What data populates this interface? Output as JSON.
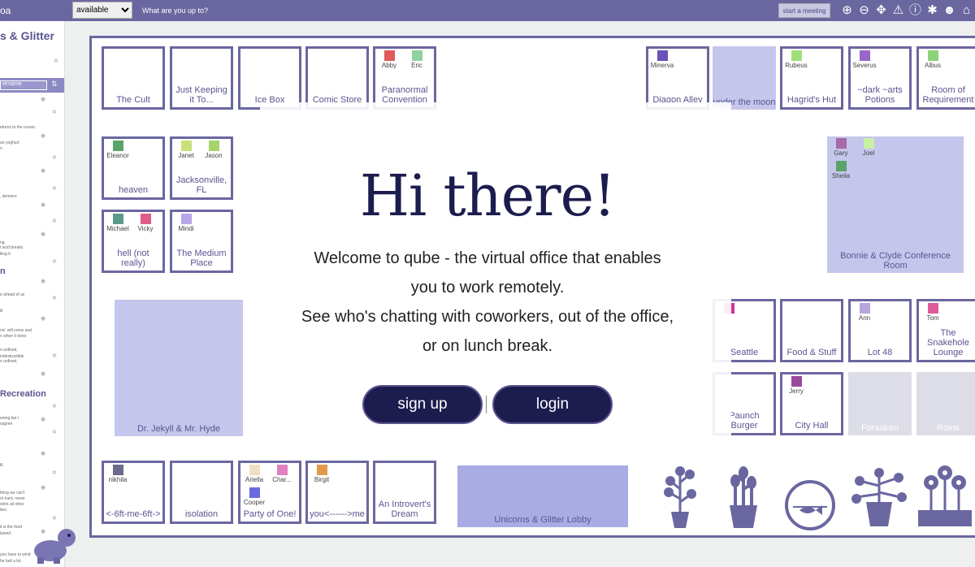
{
  "topbar": {
    "brand": "oa",
    "availability": "available",
    "status_placeholder": "What are you up to?",
    "meeting_button": "start a meeting",
    "icons": [
      "zoom-in-icon",
      "zoom-out-icon",
      "move-icon",
      "warning-icon",
      "info-icon",
      "bug-icon",
      "people-icon",
      "home-icon"
    ]
  },
  "sidebar": {
    "title": "s & Glitter",
    "search_placeholder": "ername",
    "section1": "n",
    "section2": "Recreation",
    "lines": [
      "eturns to the ocean.",
      "an yoghurt",
      "n",
      ", demons",
      "ng.",
      "t acid breaks",
      "lling it",
      "e ahead of us",
      "ill",
      "nic' will come and",
      "n when it does",
      "n unfixed,",
      "indestructible",
      "n unfixed,",
      "ening but i",
      "sagree",
      "ill.",
      "thing we can't",
      "rk hard, never",
      "shirk all other",
      "ties.",
      "it is the food",
      "lawed.",
      "you have to wind",
      "he ball a lot."
    ]
  },
  "rooms": [
    {
      "id": "the-cult",
      "name": "The Cult",
      "people": []
    },
    {
      "id": "just-keeping",
      "name": "Just Keeping it To...",
      "people": []
    },
    {
      "id": "ice-box",
      "name": "Ice Box",
      "people": []
    },
    {
      "id": "comic-store",
      "name": "Comic Store",
      "people": []
    },
    {
      "id": "paranormal",
      "name": "Paranormal Convention",
      "people": [
        {
          "name": "Abby",
          "color": "#e05a5a"
        },
        {
          "name": "Eric",
          "color": "#8fd19e"
        }
      ]
    },
    {
      "id": "diagon-alley",
      "name": "Diagon Alley",
      "people": [
        {
          "name": "Minerva",
          "color": "#6a52b8"
        }
      ]
    },
    {
      "id": "under-the-moon",
      "name": "under the moon",
      "people": []
    },
    {
      "id": "hagrids-hut",
      "name": "Hagrid's Hut",
      "people": [
        {
          "name": "Rubeus",
          "color": "#9fe07a"
        }
      ]
    },
    {
      "id": "dark-arts",
      "name": "~dark ~arts Potions",
      "people": [
        {
          "name": "Severus",
          "color": "#9a66cc"
        }
      ]
    },
    {
      "id": "room-of-req",
      "name": "Room of Requirement",
      "people": [
        {
          "name": "Albus",
          "color": "#8fd17a"
        }
      ]
    },
    {
      "id": "heaven",
      "name": "heaven",
      "people": [
        {
          "name": "Eleanor",
          "color": "#5aa46a"
        }
      ]
    },
    {
      "id": "jacksonville",
      "name": "Jacksonville, FL",
      "people": [
        {
          "name": "Janet",
          "color": "#c8e07a"
        },
        {
          "name": "Jason",
          "color": "#a6d46a"
        }
      ]
    },
    {
      "id": "hell",
      "name": "hell (not really)",
      "people": [
        {
          "name": "Michael",
          "color": "#5a9a8a"
        },
        {
          "name": "Vicky",
          "color": "#e05a8a"
        }
      ]
    },
    {
      "id": "medium-place",
      "name": "The Medium Place",
      "people": [
        {
          "name": "Mindi",
          "color": "#b8a6e8"
        }
      ]
    },
    {
      "id": "bonnie-clyde",
      "name": "Bonnie & Clyde Conference Room",
      "people": [
        {
          "name": "Gary",
          "color": "#a66aa6"
        },
        {
          "name": "Joel",
          "color": "#c8f0a6"
        },
        {
          "name": "Sheila",
          "color": "#5aa46a"
        }
      ]
    },
    {
      "id": "dr-jekyll",
      "name": "Dr. Jekyll & Mr. Hyde",
      "people": []
    },
    {
      "id": "seattle",
      "name": "Seattle",
      "people": [
        {
          "name": "",
          "color": "#cc3399"
        }
      ]
    },
    {
      "id": "food-stuff",
      "name": "Food & Stuff",
      "people": []
    },
    {
      "id": "lot-48",
      "name": "Lot 48",
      "people": [
        {
          "name": "Ann",
          "color": "#b8a6d8"
        }
      ]
    },
    {
      "id": "snakehole",
      "name": "The Snakehole Lounge",
      "people": [
        {
          "name": "Tom",
          "color": "#e05a9a"
        }
      ]
    },
    {
      "id": "paunch-burger",
      "name": "Paunch Burger",
      "people": []
    },
    {
      "id": "city-hall",
      "name": "City Hall",
      "people": [
        {
          "name": "Jerry",
          "color": "#9a4a9a"
        }
      ]
    },
    {
      "id": "forsaken",
      "name": "Forsaken",
      "people": []
    },
    {
      "id": "roins",
      "name": "Roins",
      "people": []
    },
    {
      "id": "6ft",
      "name": "<-6ft-me-6ft->",
      "people": [
        {
          "name": "nikhila",
          "color": "#6a6a8a"
        }
      ]
    },
    {
      "id": "isolation",
      "name": "isolation",
      "people": []
    },
    {
      "id": "party-of-one",
      "name": "Party of One!",
      "people": [
        {
          "name": "Ariella",
          "color": "#f0e0c0"
        },
        {
          "name": "Char...",
          "color": "#e080c0"
        },
        {
          "name": "Cooper",
          "color": "#6a6ae0"
        }
      ]
    },
    {
      "id": "you-me",
      "name": "you<------>me",
      "people": [
        {
          "name": "Birgit",
          "color": "#e09a4a"
        }
      ]
    },
    {
      "id": "introvert",
      "name": "An Introvert's Dream",
      "people": []
    },
    {
      "id": "lobby",
      "name": "Unicorns & Glitter Lobby",
      "people": []
    }
  ],
  "welcome": {
    "title": "Hi there!",
    "lines": [
      "Welcome to qube - the virtual office that enables",
      "you to work remotely.",
      "See who's chatting with coworkers, out of the office,",
      "or on lunch break."
    ],
    "signup": "sign up",
    "login": "login"
  },
  "decor": [
    "plant-icon",
    "plant-icon",
    "fishbowl-icon",
    "plant-icon",
    "flowers-icon",
    "turtle-icon"
  ]
}
